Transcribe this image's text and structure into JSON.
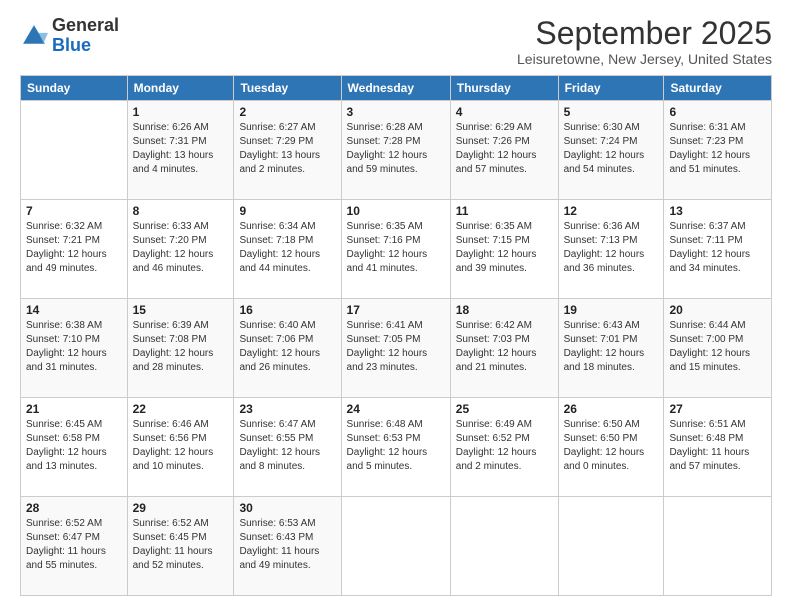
{
  "logo": {
    "general": "General",
    "blue": "Blue"
  },
  "header": {
    "title": "September 2025",
    "subtitle": "Leisuretowne, New Jersey, United States"
  },
  "days": [
    "Sunday",
    "Monday",
    "Tuesday",
    "Wednesday",
    "Thursday",
    "Friday",
    "Saturday"
  ],
  "weeks": [
    [
      {
        "day": "",
        "sunrise": "",
        "sunset": "",
        "daylight": ""
      },
      {
        "day": "1",
        "sunrise": "Sunrise: 6:26 AM",
        "sunset": "Sunset: 7:31 PM",
        "daylight": "Daylight: 13 hours and 4 minutes."
      },
      {
        "day": "2",
        "sunrise": "Sunrise: 6:27 AM",
        "sunset": "Sunset: 7:29 PM",
        "daylight": "Daylight: 13 hours and 2 minutes."
      },
      {
        "day": "3",
        "sunrise": "Sunrise: 6:28 AM",
        "sunset": "Sunset: 7:28 PM",
        "daylight": "Daylight: 12 hours and 59 minutes."
      },
      {
        "day": "4",
        "sunrise": "Sunrise: 6:29 AM",
        "sunset": "Sunset: 7:26 PM",
        "daylight": "Daylight: 12 hours and 57 minutes."
      },
      {
        "day": "5",
        "sunrise": "Sunrise: 6:30 AM",
        "sunset": "Sunset: 7:24 PM",
        "daylight": "Daylight: 12 hours and 54 minutes."
      },
      {
        "day": "6",
        "sunrise": "Sunrise: 6:31 AM",
        "sunset": "Sunset: 7:23 PM",
        "daylight": "Daylight: 12 hours and 51 minutes."
      }
    ],
    [
      {
        "day": "7",
        "sunrise": "Sunrise: 6:32 AM",
        "sunset": "Sunset: 7:21 PM",
        "daylight": "Daylight: 12 hours and 49 minutes."
      },
      {
        "day": "8",
        "sunrise": "Sunrise: 6:33 AM",
        "sunset": "Sunset: 7:20 PM",
        "daylight": "Daylight: 12 hours and 46 minutes."
      },
      {
        "day": "9",
        "sunrise": "Sunrise: 6:34 AM",
        "sunset": "Sunset: 7:18 PM",
        "daylight": "Daylight: 12 hours and 44 minutes."
      },
      {
        "day": "10",
        "sunrise": "Sunrise: 6:35 AM",
        "sunset": "Sunset: 7:16 PM",
        "daylight": "Daylight: 12 hours and 41 minutes."
      },
      {
        "day": "11",
        "sunrise": "Sunrise: 6:35 AM",
        "sunset": "Sunset: 7:15 PM",
        "daylight": "Daylight: 12 hours and 39 minutes."
      },
      {
        "day": "12",
        "sunrise": "Sunrise: 6:36 AM",
        "sunset": "Sunset: 7:13 PM",
        "daylight": "Daylight: 12 hours and 36 minutes."
      },
      {
        "day": "13",
        "sunrise": "Sunrise: 6:37 AM",
        "sunset": "Sunset: 7:11 PM",
        "daylight": "Daylight: 12 hours and 34 minutes."
      }
    ],
    [
      {
        "day": "14",
        "sunrise": "Sunrise: 6:38 AM",
        "sunset": "Sunset: 7:10 PM",
        "daylight": "Daylight: 12 hours and 31 minutes."
      },
      {
        "day": "15",
        "sunrise": "Sunrise: 6:39 AM",
        "sunset": "Sunset: 7:08 PM",
        "daylight": "Daylight: 12 hours and 28 minutes."
      },
      {
        "day": "16",
        "sunrise": "Sunrise: 6:40 AM",
        "sunset": "Sunset: 7:06 PM",
        "daylight": "Daylight: 12 hours and 26 minutes."
      },
      {
        "day": "17",
        "sunrise": "Sunrise: 6:41 AM",
        "sunset": "Sunset: 7:05 PM",
        "daylight": "Daylight: 12 hours and 23 minutes."
      },
      {
        "day": "18",
        "sunrise": "Sunrise: 6:42 AM",
        "sunset": "Sunset: 7:03 PM",
        "daylight": "Daylight: 12 hours and 21 minutes."
      },
      {
        "day": "19",
        "sunrise": "Sunrise: 6:43 AM",
        "sunset": "Sunset: 7:01 PM",
        "daylight": "Daylight: 12 hours and 18 minutes."
      },
      {
        "day": "20",
        "sunrise": "Sunrise: 6:44 AM",
        "sunset": "Sunset: 7:00 PM",
        "daylight": "Daylight: 12 hours and 15 minutes."
      }
    ],
    [
      {
        "day": "21",
        "sunrise": "Sunrise: 6:45 AM",
        "sunset": "Sunset: 6:58 PM",
        "daylight": "Daylight: 12 hours and 13 minutes."
      },
      {
        "day": "22",
        "sunrise": "Sunrise: 6:46 AM",
        "sunset": "Sunset: 6:56 PM",
        "daylight": "Daylight: 12 hours and 10 minutes."
      },
      {
        "day": "23",
        "sunrise": "Sunrise: 6:47 AM",
        "sunset": "Sunset: 6:55 PM",
        "daylight": "Daylight: 12 hours and 8 minutes."
      },
      {
        "day": "24",
        "sunrise": "Sunrise: 6:48 AM",
        "sunset": "Sunset: 6:53 PM",
        "daylight": "Daylight: 12 hours and 5 minutes."
      },
      {
        "day": "25",
        "sunrise": "Sunrise: 6:49 AM",
        "sunset": "Sunset: 6:52 PM",
        "daylight": "Daylight: 12 hours and 2 minutes."
      },
      {
        "day": "26",
        "sunrise": "Sunrise: 6:50 AM",
        "sunset": "Sunset: 6:50 PM",
        "daylight": "Daylight: 12 hours and 0 minutes."
      },
      {
        "day": "27",
        "sunrise": "Sunrise: 6:51 AM",
        "sunset": "Sunset: 6:48 PM",
        "daylight": "Daylight: 11 hours and 57 minutes."
      }
    ],
    [
      {
        "day": "28",
        "sunrise": "Sunrise: 6:52 AM",
        "sunset": "Sunset: 6:47 PM",
        "daylight": "Daylight: 11 hours and 55 minutes."
      },
      {
        "day": "29",
        "sunrise": "Sunrise: 6:52 AM",
        "sunset": "Sunset: 6:45 PM",
        "daylight": "Daylight: 11 hours and 52 minutes."
      },
      {
        "day": "30",
        "sunrise": "Sunrise: 6:53 AM",
        "sunset": "Sunset: 6:43 PM",
        "daylight": "Daylight: 11 hours and 49 minutes."
      },
      {
        "day": "",
        "sunrise": "",
        "sunset": "",
        "daylight": ""
      },
      {
        "day": "",
        "sunrise": "",
        "sunset": "",
        "daylight": ""
      },
      {
        "day": "",
        "sunrise": "",
        "sunset": "",
        "daylight": ""
      },
      {
        "day": "",
        "sunrise": "",
        "sunset": "",
        "daylight": ""
      }
    ]
  ]
}
